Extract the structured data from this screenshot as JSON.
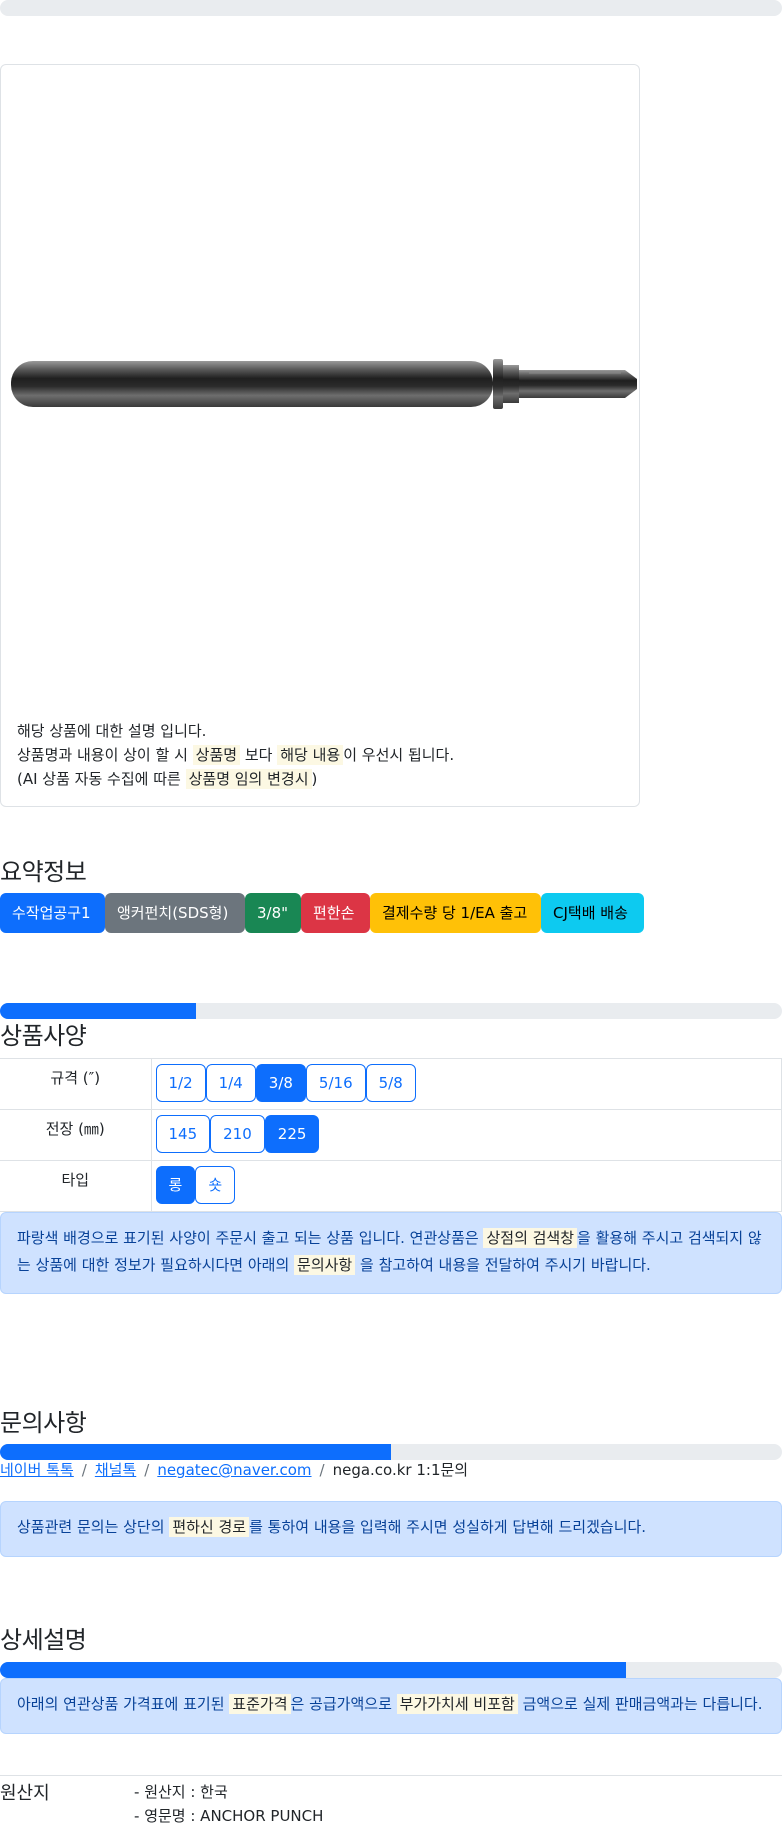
{
  "progress_top": 0,
  "image_card": {
    "product_image": "anchor punch tool",
    "text_line1": "해당 상품에 대한 설명 입니다.",
    "text_line2_a": "상품명과 내용이 상이 할 시",
    "text_line2_mark1": "상품명",
    "text_line2_b": "보다",
    "text_line2_mark2": "해당 내용",
    "text_line2_c": "이 우선시 됩니다.",
    "text_line3_a": "(AI 상품 자동 수집에 따른",
    "text_line3_mark": "상품명 임의 변경시",
    "text_line3_b": ")"
  },
  "summary": {
    "title": "요약정보",
    "badges": [
      {
        "label": "수작업공구1",
        "color": "#0d6efd"
      },
      {
        "label": "앵커펀치(SDS형)",
        "color": "#6c757d"
      },
      {
        "label": "3/8\"",
        "color": "#198754"
      },
      {
        "label": "편한손",
        "color": "#dc3545"
      },
      {
        "label": "결제수량 당 1/EA 출고",
        "color": "#ffc107"
      },
      {
        "label": "CJ택배 배송",
        "color": "#0dcaf0"
      }
    ]
  },
  "spec": {
    "progress_percent": 25,
    "title": "상품사양",
    "rows": [
      {
        "label": "규격 (″)",
        "options": [
          "1/2",
          "1/4",
          "3/8",
          "5/16",
          "5/8"
        ],
        "selected": "3/8"
      },
      {
        "label": "전장 (㎜)",
        "options": [
          "145",
          "210",
          "225"
        ],
        "selected": "225"
      },
      {
        "label": "타입",
        "options": [
          "롱",
          "숏"
        ],
        "selected": "롱"
      }
    ],
    "notice_a": "파랑색 배경으로 표기된 사양이 주문시 출고 되는 상품 입니다. 연관상품은",
    "notice_mark1": "상점의 검색창",
    "notice_b": "을 활용해 주시고 검색되지 않는 상품에 대한 정보가 필요하시다면 아래의",
    "notice_mark2": "문의사항",
    "notice_c": "을 참고하여 내용을 전달하여 주시기 바랍니다."
  },
  "inquiry": {
    "title": "문의사항",
    "progress_percent": 50,
    "links": {
      "naver": "네이버 톡톡",
      "channel": "채널톡",
      "email": "negatec@naver.com",
      "site": "nega.co.kr 1:1문의"
    },
    "notice_a": "상품관련 문의는 상단의",
    "notice_mark": "편하신 경로",
    "notice_b": "를 통하여 내용을 입력해 주시면 성실하게 답변해 드리겠습니다."
  },
  "detail": {
    "title": "상세설명",
    "progress_percent": 80,
    "notice_a": "아래의 연관상품 가격표에 표기된",
    "notice_mark1": "표준가격",
    "notice_b": "은 공급가액으로",
    "notice_mark2": "부가가치세 비포함",
    "notice_c": "금액으로 실제 판매금액과는 다릅니다."
  },
  "origin": {
    "label": "원산지",
    "items": [
      "원산지 : 한국",
      "영문명 : ANCHOR PUNCH"
    ]
  }
}
